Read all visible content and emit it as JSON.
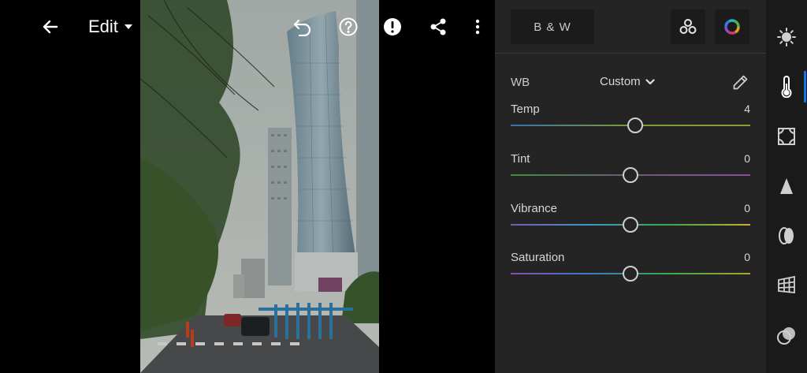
{
  "topbar": {
    "edit_label": "Edit"
  },
  "panel": {
    "bw_label": "B & W",
    "wb": {
      "label": "WB",
      "selected": "Custom"
    },
    "sliders": [
      {
        "label": "Temp",
        "value": "4",
        "position": 0.52,
        "gradient": [
          "#3a6fae",
          "#7a9a3a",
          "#8a9f2e"
        ]
      },
      {
        "label": "Tint",
        "value": "0",
        "position": 0.5,
        "gradient": [
          "#3e8e3e",
          "#6a5a7a",
          "#8a4e9a"
        ]
      },
      {
        "label": "Vibrance",
        "value": "0",
        "position": 0.5,
        "gradient": [
          "#7a5ab0",
          "#3a9ac8",
          "#3aaa4a",
          "#c8b030"
        ]
      },
      {
        "label": "Saturation",
        "value": "0",
        "position": 0.5,
        "gradient": [
          "#8a4ab0",
          "#3a7ac8",
          "#3aaa4a",
          "#b0a030"
        ]
      }
    ]
  },
  "rail": {
    "items": [
      {
        "icon": "light-icon"
      },
      {
        "icon": "color-temperature-icon"
      },
      {
        "icon": "effects-icon"
      },
      {
        "icon": "detail-icon"
      },
      {
        "icon": "optics-icon"
      },
      {
        "icon": "geometry-icon"
      },
      {
        "icon": "mask-icon"
      }
    ],
    "active_index": 1
  },
  "colors": {
    "accent": "#1473e6",
    "panel_bg": "#242424",
    "rail_bg": "#1a1a1a"
  }
}
